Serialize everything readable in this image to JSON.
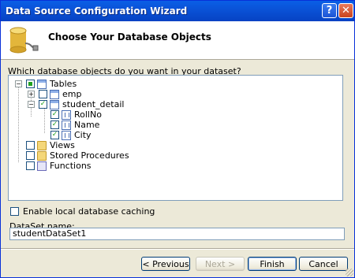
{
  "window": {
    "title": "Data Source Configuration Wizard",
    "help_glyph": "?",
    "close_glyph": "✕"
  },
  "header": {
    "title": "Choose Your Database Objects",
    "icon": "database-plug-icon"
  },
  "prompt": "Which database objects do you want in your dataset?",
  "tree": {
    "root": {
      "label": "Tables",
      "expanded": true,
      "state": "partial"
    },
    "emp": {
      "label": "emp",
      "expanded": false,
      "state": "unchecked"
    },
    "student_detail": {
      "label": "student_detail",
      "expanded": true,
      "state": "checked"
    },
    "columns": [
      {
        "label": "RollNo",
        "state": "checked"
      },
      {
        "label": "Name",
        "state": "checked"
      },
      {
        "label": "City",
        "state": "checked"
      }
    ],
    "views": {
      "label": "Views",
      "state": "unchecked"
    },
    "stored_procedures": {
      "label": "Stored Procedures",
      "state": "unchecked"
    },
    "functions": {
      "label": "Functions",
      "state": "unchecked"
    }
  },
  "caching": {
    "label": "Enable local database caching",
    "checked": false
  },
  "dataset": {
    "label": "DataSet name:",
    "value": "studentDataSet1"
  },
  "buttons": {
    "previous": "< Previous",
    "next": "Next >",
    "finish": "Finish",
    "cancel": "Cancel"
  },
  "colors": {
    "titlebar": "#0a53d8",
    "check": "#21a121",
    "dialog": "#ece9d8"
  }
}
